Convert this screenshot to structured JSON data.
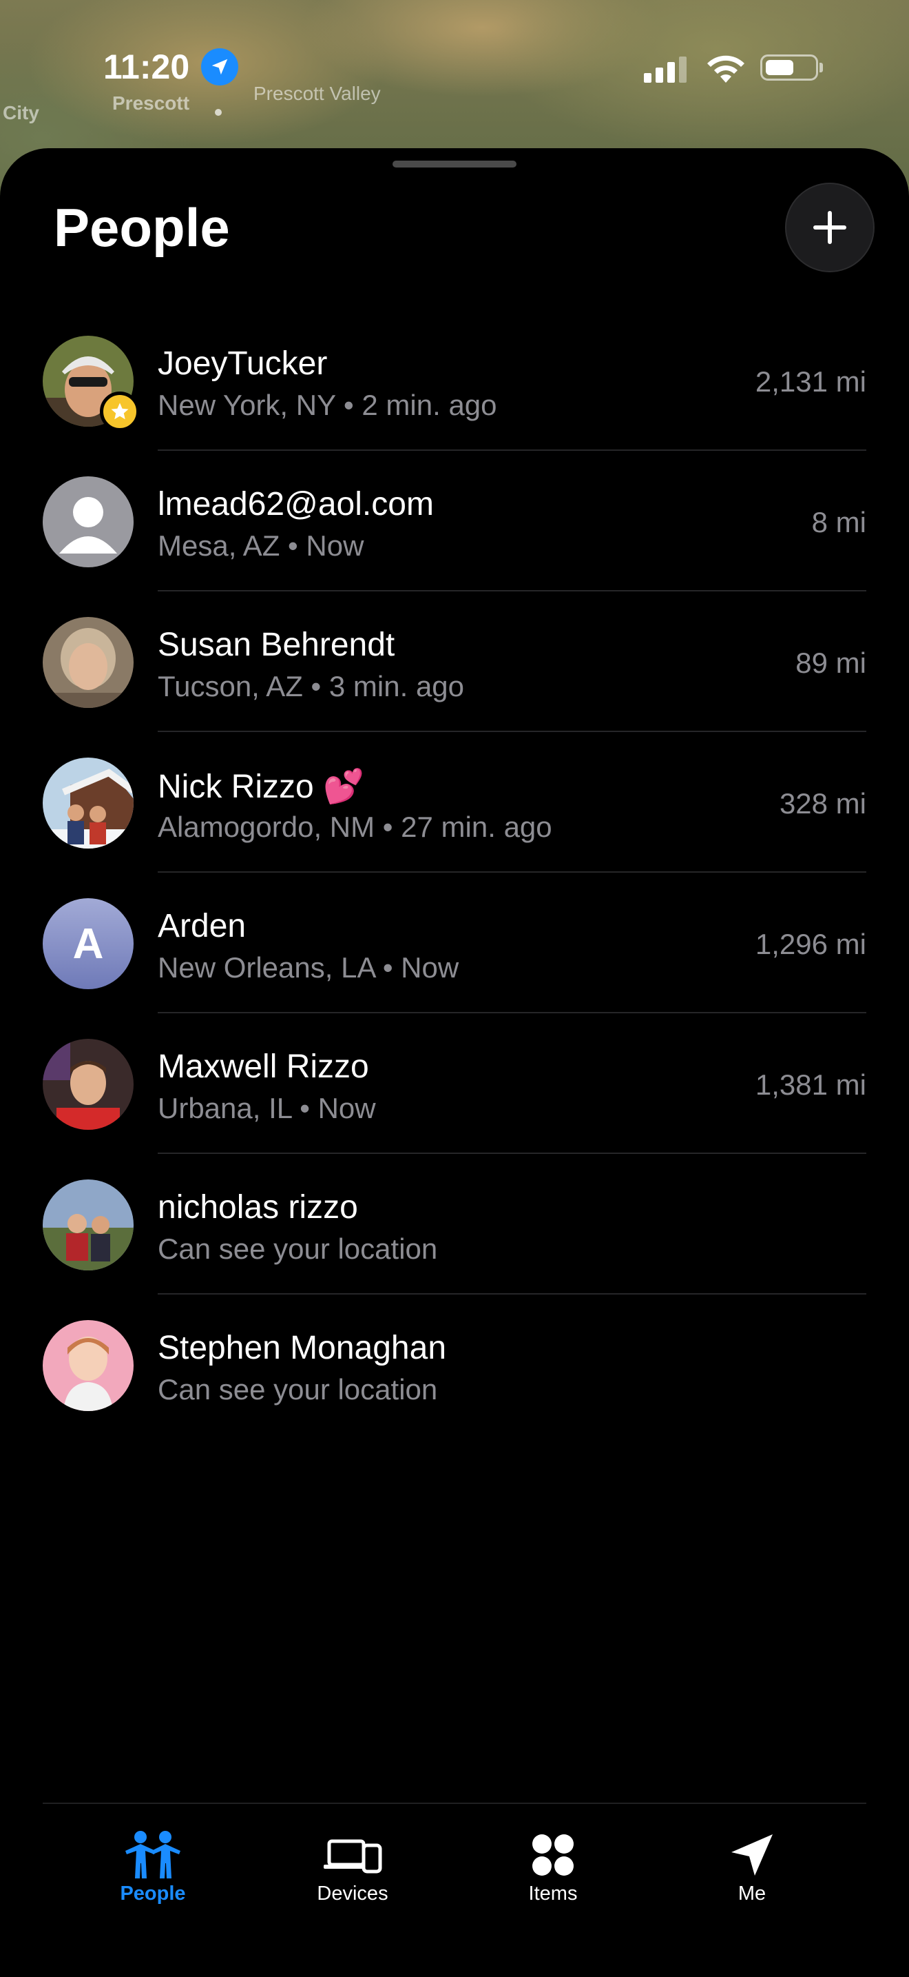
{
  "status_bar": {
    "time": "11:20"
  },
  "map": {
    "labels": [
      "City",
      "Prescott",
      "Prescott Valley"
    ]
  },
  "sheet": {
    "title": "People"
  },
  "people": [
    {
      "name": "JoeyTucker",
      "subtitle": "New York, NY • 2 min. ago",
      "distance": "2,131 mi"
    },
    {
      "name": "lmead62@aol.com",
      "subtitle": "Mesa, AZ • Now",
      "distance": "8 mi"
    },
    {
      "name": "Susan Behrendt",
      "subtitle": "Tucson, AZ • 3 min. ago",
      "distance": "89 mi"
    },
    {
      "name": "Nick Rizzo 💕",
      "subtitle": "Alamogordo, NM • 27 min. ago",
      "distance": "328 mi"
    },
    {
      "name": "Arden",
      "subtitle": "New Orleans, LA • Now",
      "distance": "1,296 mi",
      "initial": "A"
    },
    {
      "name": "Maxwell Rizzo",
      "subtitle": "Urbana, IL • Now",
      "distance": "1,381 mi"
    },
    {
      "name": "nicholas rizzo",
      "subtitle": "Can see your location",
      "distance": ""
    },
    {
      "name": "Stephen Monaghan",
      "subtitle": "Can see your location",
      "distance": ""
    }
  ],
  "tabs": [
    {
      "label": "People",
      "icon": "people-icon",
      "active": true
    },
    {
      "label": "Devices",
      "icon": "devices-icon",
      "active": false
    },
    {
      "label": "Items",
      "icon": "items-icon",
      "active": false
    },
    {
      "label": "Me",
      "icon": "location-arrow-icon",
      "active": false
    }
  ],
  "colors": {
    "accent": "#1a8cff",
    "secondary_text": "#8d8d93",
    "badge": "#f7c52b"
  }
}
